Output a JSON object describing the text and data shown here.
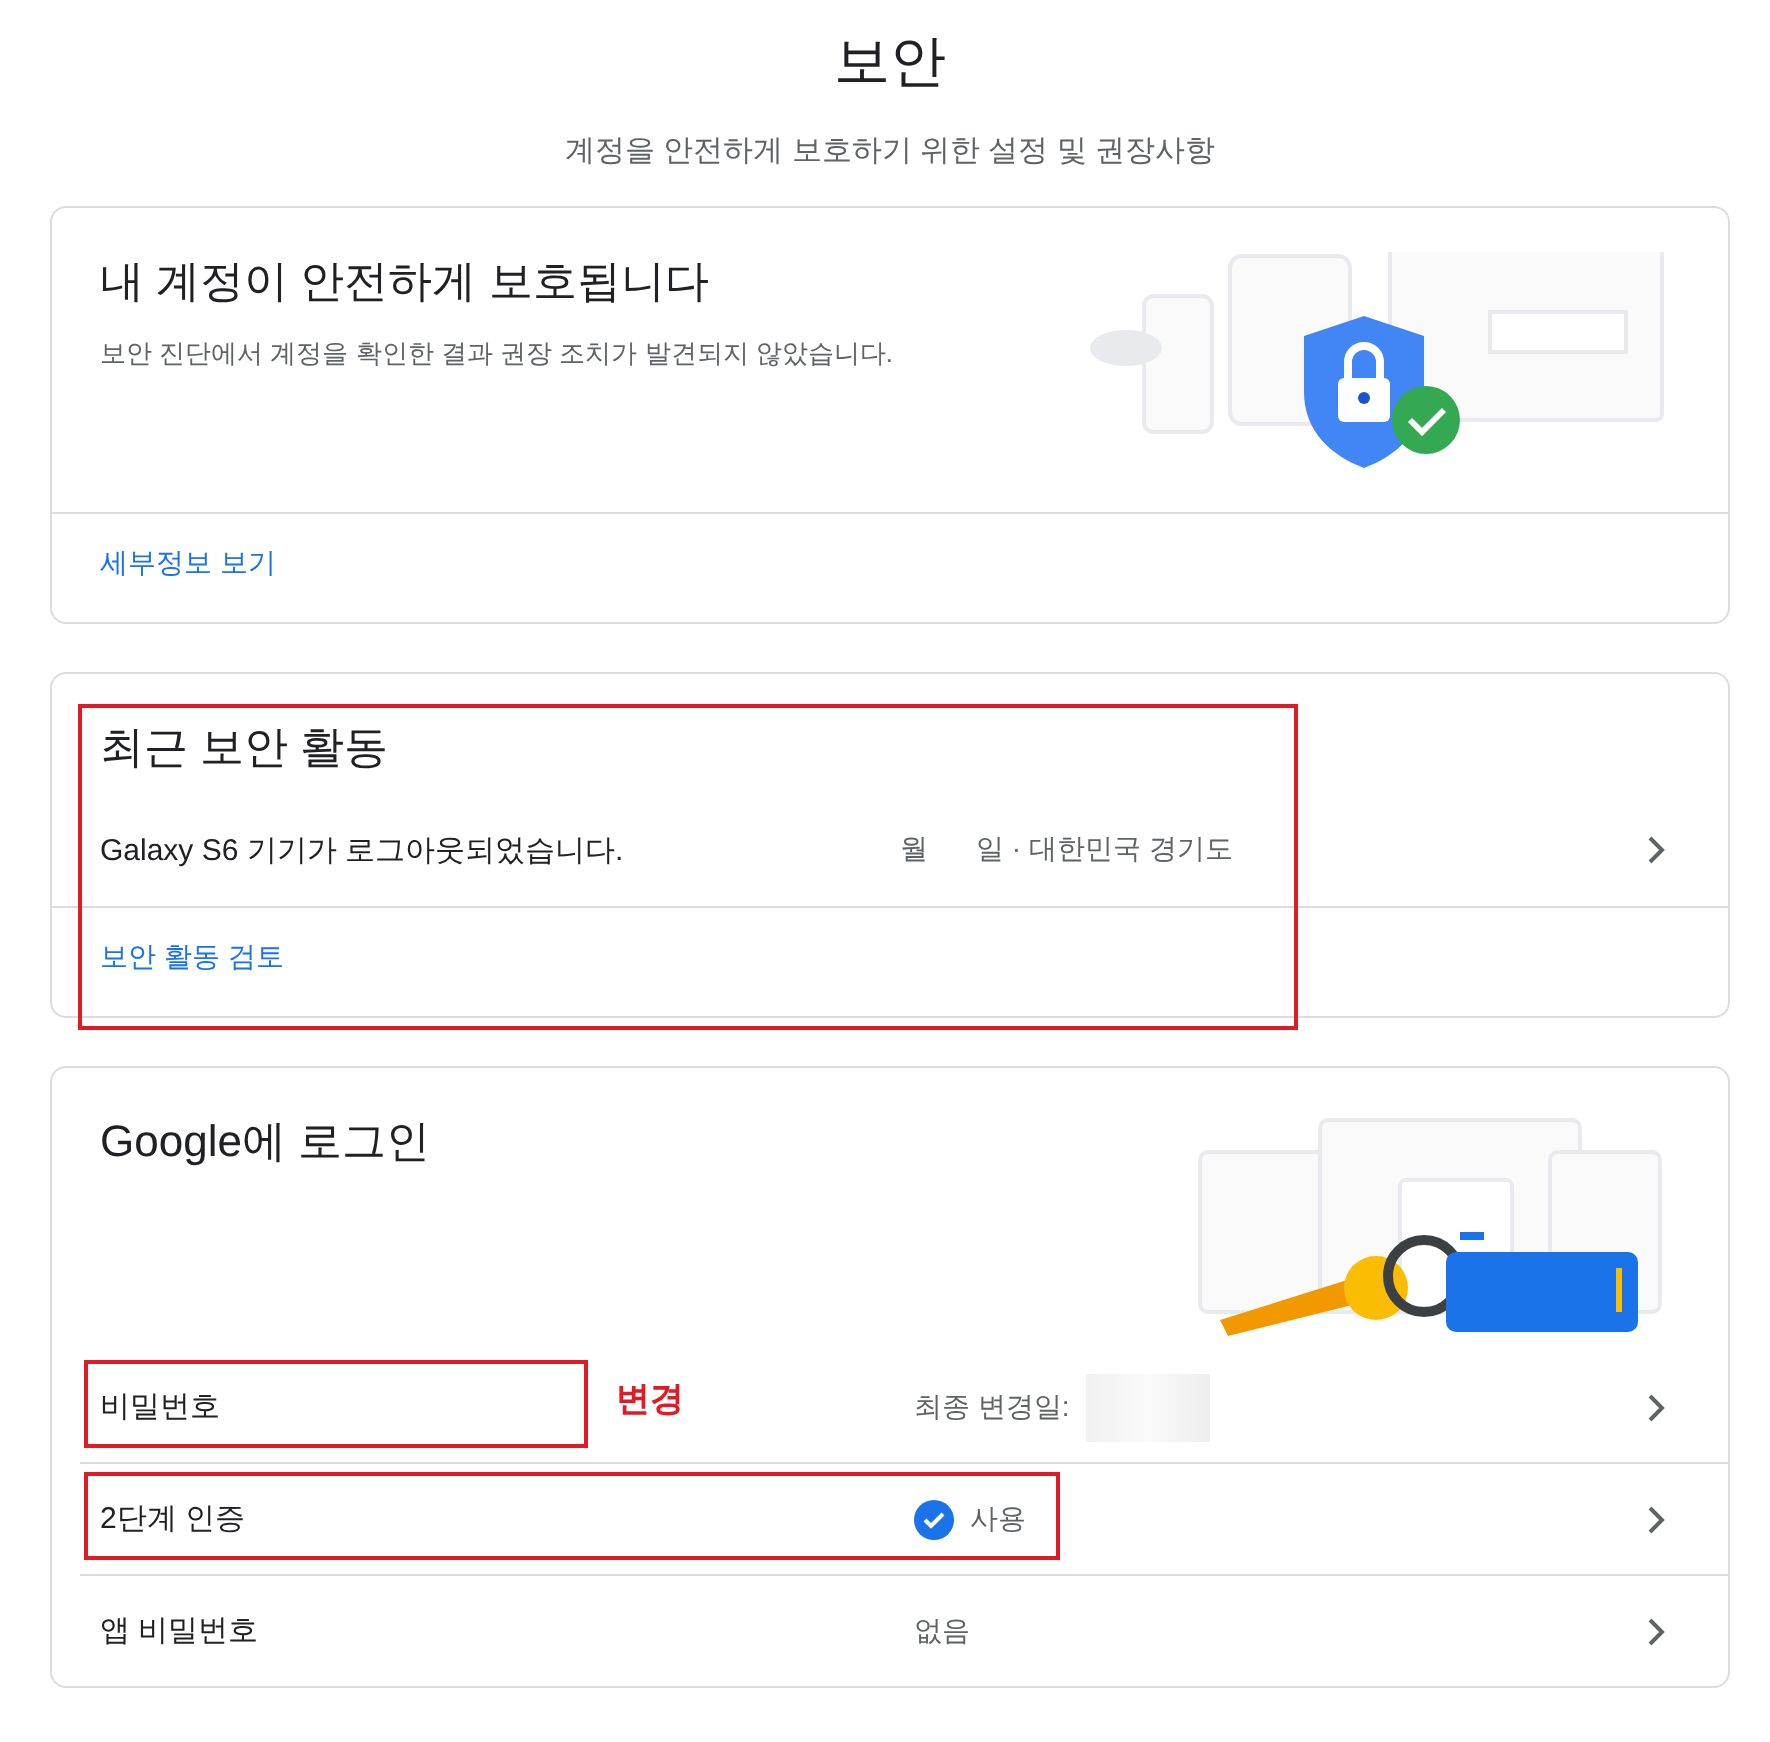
{
  "page": {
    "title": "보안",
    "subtitle": "계정을 안전하게 보호하기 위한 설정 및 권장사항"
  },
  "status_card": {
    "title": "내 계정이 안전하게 보호됩니다",
    "description": "보안 진단에서 계정을 확인한 결과 권장 조치가 발견되지 않았습니다.",
    "link": "세부정보 보기"
  },
  "recent_activity": {
    "title": "최근 보안 활동",
    "highlighted": true,
    "events": [
      {
        "text": "Galaxy S6 기기가 로그아웃되었습니다.",
        "month": "월",
        "day_location": "일 · 대한민국 경기도"
      }
    ],
    "link": "보안 활동 검토"
  },
  "sign_in": {
    "title": "Google에 로그인",
    "rows": [
      {
        "kind": "date",
        "label": "비밀번호",
        "value": "최종 변경일:",
        "redacted": true,
        "highlighted": true,
        "note": "변경"
      },
      {
        "kind": "status",
        "label": "2단계 인증",
        "value": "사용",
        "checked": true,
        "highlighted": true
      },
      {
        "kind": "text",
        "label": "앱 비밀번호",
        "value": "없음",
        "highlighted": false
      }
    ]
  }
}
